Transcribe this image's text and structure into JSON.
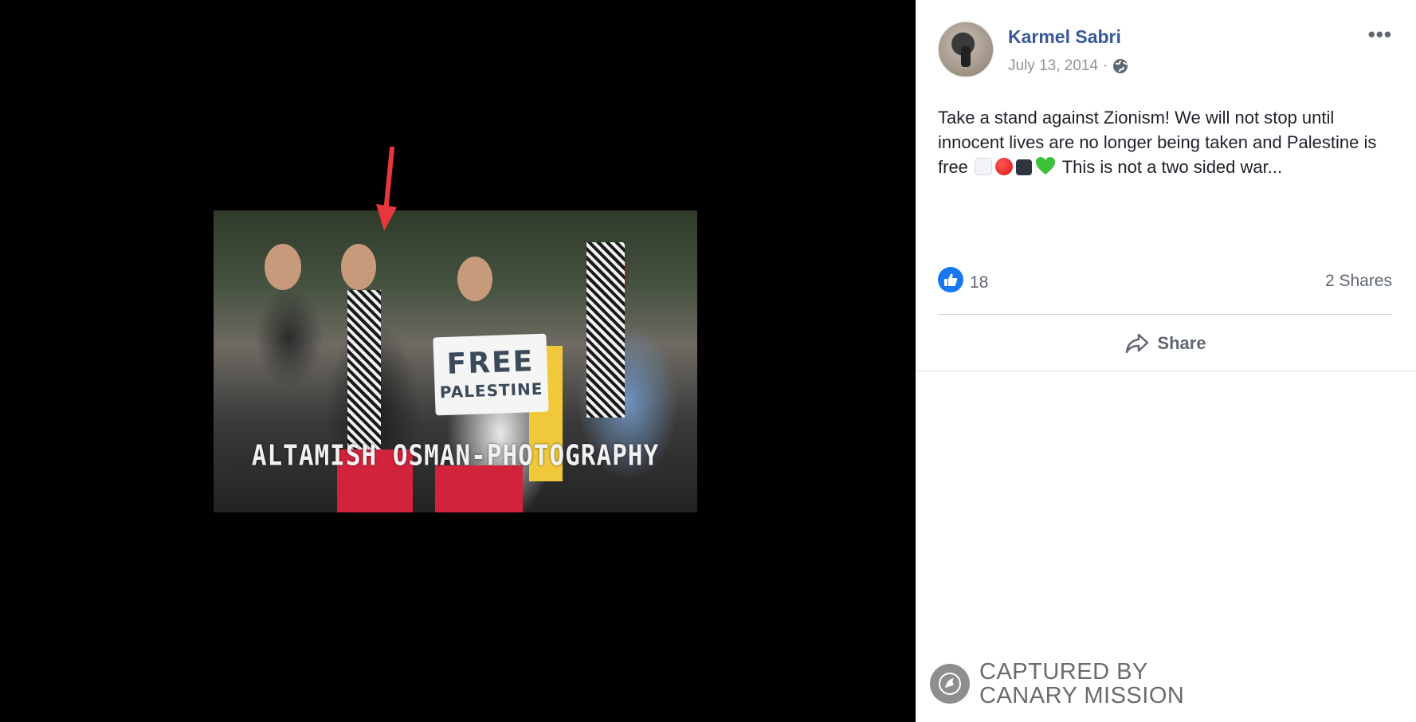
{
  "photo": {
    "sign_line1": "FREE",
    "sign_line2": "PALESTINE",
    "watermark": "ALTAMISH OSMAN-PHOTOGRAPHY",
    "arrow_color": "#e8373b"
  },
  "post": {
    "author": "Karmel Sabri",
    "date": "July 13, 2014",
    "date_separator": "·",
    "privacy_icon": "globe-icon",
    "more_icon": "•••",
    "text_before_emoji": "Take a stand against Zionism! We will not stop until innocent lives are no longer being taken and Palestine is free ",
    "emojis": [
      "white-square",
      "red-circle",
      "black-square",
      "green-heart"
    ],
    "text_after_emoji": " This is not a two sided war..."
  },
  "engagement": {
    "like_icon": "thumbs-up-icon",
    "likes_count": "18",
    "shares": "2 Shares"
  },
  "actions": {
    "share_label": "Share",
    "share_icon": "share-arrow-icon"
  },
  "stamp": {
    "line1": "CAPTURED BY",
    "line2": "CANARY MISSION"
  },
  "colors": {
    "author_link": "#385898",
    "like_blue": "#1877f2",
    "viewer_bg": "#000000"
  }
}
